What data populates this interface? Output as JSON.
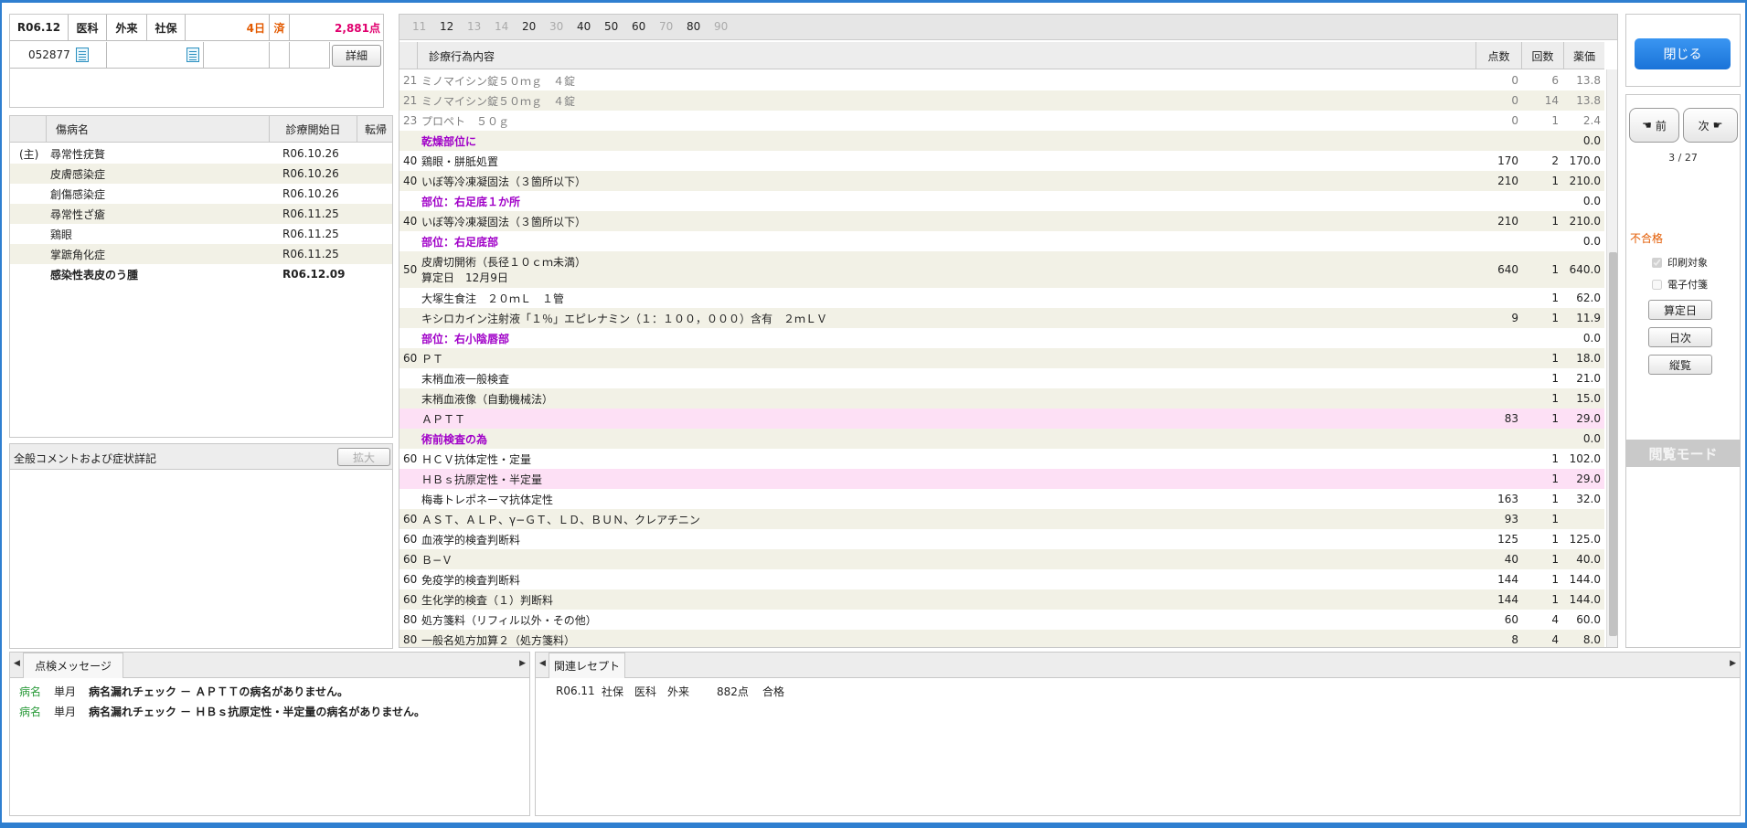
{
  "header": {
    "ym": "R06.12",
    "dept": "医科",
    "visit_type": "外来",
    "insurance": "社保",
    "days": "4日",
    "done": "済",
    "points": "2,881点",
    "patient_id": "052877",
    "detail_button": "詳細"
  },
  "disease_list": {
    "col_name": "傷病名",
    "col_start": "診療開始日",
    "col_outcome": "転帰",
    "rows": [
      {
        "main": "(主)",
        "name": "尋常性疣贅",
        "start": "R06.10.26"
      },
      {
        "main": "",
        "name": "皮膚感染症",
        "start": "R06.10.26"
      },
      {
        "main": "",
        "name": "創傷感染症",
        "start": "R06.10.26"
      },
      {
        "main": "",
        "name": "尋常性ざ瘡",
        "start": "R06.11.25"
      },
      {
        "main": "",
        "name": "鶏眼",
        "start": "R06.11.25"
      },
      {
        "main": "",
        "name": "掌蹠角化症",
        "start": "R06.11.25"
      },
      {
        "main": "",
        "name": "感染性表皮のう腫",
        "start": "R06.12.09"
      }
    ]
  },
  "comment": {
    "title": "全般コメントおよび症状詳記",
    "expand_button": "拡大"
  },
  "day_tabs": [
    "11",
    "12",
    "13",
    "14",
    "20",
    "30",
    "40",
    "50",
    "60",
    "70",
    "80",
    "90"
  ],
  "day_tabs_active": [
    false,
    true,
    false,
    false,
    true,
    false,
    true,
    true,
    true,
    false,
    true,
    false
  ],
  "main_grid": {
    "col_content": "診療行為内容",
    "col_points": "点数",
    "col_count": "回数",
    "col_price": "薬価",
    "rows": [
      {
        "code": "21",
        "name": "ミノマイシン錠５０ｍｇ　４錠",
        "points": "0",
        "count": "6",
        "price": "13.8"
      },
      {
        "code": "21",
        "name": "ミノマイシン錠５０ｍｇ　４錠",
        "points": "0",
        "count": "14",
        "price": "13.8"
      },
      {
        "code": "23",
        "name": "プロペト　５０ｇ",
        "points": "0",
        "count": "1",
        "price": "2.4"
      },
      {
        "code": "",
        "name": "乾燥部位に",
        "points": "",
        "count": "",
        "price": "0.0"
      },
      {
        "code": "40",
        "name": "鶏眼・胼胝処置",
        "points": "170",
        "count": "2",
        "price": "170.0"
      },
      {
        "code": "40",
        "name": "いぼ等冷凍凝固法（３箇所以下）",
        "points": "210",
        "count": "1",
        "price": "210.0"
      },
      {
        "code": "",
        "name": "部位：右足底１か所",
        "points": "",
        "count": "",
        "price": "0.0"
      },
      {
        "code": "40",
        "name": "いぼ等冷凍凝固法（３箇所以下）",
        "points": "210",
        "count": "1",
        "price": "210.0"
      },
      {
        "code": "",
        "name": "部位：右足底部",
        "points": "",
        "count": "",
        "price": "0.0"
      },
      {
        "code": "50",
        "name": "皮膚切開術（長径１０ｃｍ未満）",
        "name2": "算定日　12月9日",
        "points": "640",
        "count": "1",
        "price": "640.0"
      },
      {
        "code": "",
        "name": "大塚生食注　２０ｍＬ　１管",
        "points": "",
        "count": "1",
        "price": "62.0"
      },
      {
        "code": "",
        "name": "キシロカイン注射液「１％」エピレナミン（１：１００，０００）含有　２ｍＬＶ",
        "points": "9",
        "count": "1",
        "price": "11.9"
      },
      {
        "code": "",
        "name": "部位：右小陰唇部",
        "points": "",
        "count": "",
        "price": "0.0"
      },
      {
        "code": "60",
        "name": "ＰＴ",
        "points": "",
        "count": "1",
        "price": "18.0"
      },
      {
        "code": "",
        "name": "末梢血液一般検査",
        "points": "",
        "count": "1",
        "price": "21.0"
      },
      {
        "code": "",
        "name": "末梢血液像（自動機械法）",
        "points": "",
        "count": "1",
        "price": "15.0"
      },
      {
        "code": "",
        "name": "ＡＰＴＴ",
        "points": "83",
        "count": "1",
        "price": "29.0"
      },
      {
        "code": "",
        "name": "術前検査の為",
        "points": "",
        "count": "",
        "price": "0.0"
      },
      {
        "code": "60",
        "name": "ＨＣＶ抗体定性・定量",
        "points": "",
        "count": "1",
        "price": "102.0"
      },
      {
        "code": "",
        "name": "ＨＢｓ抗原定性・半定量",
        "points": "",
        "count": "1",
        "price": "29.0"
      },
      {
        "code": "",
        "name": "梅毒トレポネーマ抗体定性",
        "points": "163",
        "count": "1",
        "price": "32.0"
      },
      {
        "code": "60",
        "name": "ＡＳＴ、ＡＬＰ、γ−ＧＴ、ＬＤ、ＢＵＮ、クレアチニン",
        "points": "93",
        "count": "1",
        "price": ""
      },
      {
        "code": "60",
        "name": "血液学的検査判断料",
        "points": "125",
        "count": "1",
        "price": "125.0"
      },
      {
        "code": "60",
        "name": "Ｂ−Ｖ",
        "points": "40",
        "count": "1",
        "price": "40.0"
      },
      {
        "code": "60",
        "name": "免疫学的検査判断料",
        "points": "144",
        "count": "1",
        "price": "144.0"
      },
      {
        "code": "60",
        "name": "生化学的検査（１）判断料",
        "points": "144",
        "count": "1",
        "price": "144.0"
      },
      {
        "code": "80",
        "name": "処方箋料（リフィル以外・その他）",
        "points": "60",
        "count": "4",
        "price": "60.0"
      },
      {
        "code": "80",
        "name": "一般名処方加算２（処方箋料）",
        "points": "8",
        "count": "4",
        "price": "8.0"
      }
    ]
  },
  "right": {
    "close_button": "閉じる",
    "prev_button": "前",
    "next_button": "次",
    "page_counter": "3 / 27",
    "status": "不合格",
    "print_target": "印刷対象",
    "e_attach": "電子付箋",
    "calc_day_button": "算定日",
    "daily_button": "日次",
    "overview_button": "縦覧",
    "mode_label": "閲覧モード",
    "colors": {
      "accent": "#1a73d8",
      "status": "#e35a00",
      "mode_bg": "#c9c9c9"
    }
  },
  "messages": {
    "title": "点検メッセージ",
    "rows": [
      {
        "type": "病名",
        "period": "単月",
        "text": "病名漏れチェック － ＡＰＴＴの病名がありません。"
      },
      {
        "type": "病名",
        "period": "単月",
        "text": "病名漏れチェック － ＨＢｓ抗原定性・半定量の病名がありません。"
      }
    ]
  },
  "related": {
    "title": "関連レセプト",
    "rows": [
      {
        "ym": "R06.11",
        "ins": "社保",
        "dept": "医科",
        "visit": "外来",
        "points": "882点",
        "result": "合格"
      }
    ]
  }
}
